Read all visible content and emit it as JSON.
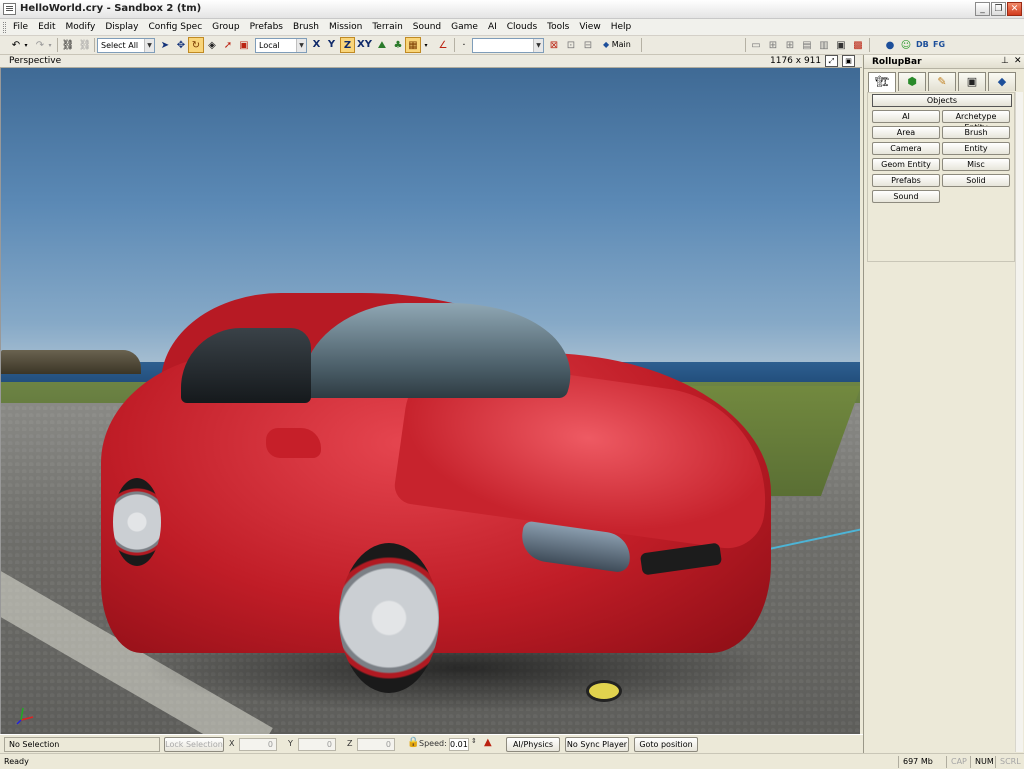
{
  "window": {
    "title": "HelloWorld.cry - Sandbox 2 (tm)",
    "minimize": "_",
    "restore": "❐",
    "close": "✕"
  },
  "menu": [
    "File",
    "Edit",
    "Modify",
    "Display",
    "Config Spec",
    "Group",
    "Prefabs",
    "Brush",
    "Mission",
    "Terrain",
    "Sound",
    "Game",
    "AI",
    "Clouds",
    "Tools",
    "View",
    "Help"
  ],
  "toolbar": {
    "selection_combo": "Select All",
    "coord_combo": "Local",
    "axes": [
      "X",
      "Y",
      "Z",
      "XY"
    ],
    "active_axis": "Z",
    "layer_combo": "",
    "layer_label": "Main",
    "db_label": "DB",
    "fg_label": "FG",
    "icons": [
      "undo-icon",
      "redo-icon",
      "link-icon",
      "unlink-icon",
      "select-icon",
      "move-icon",
      "rotate-icon",
      "scale-icon",
      "select-terrain-icon",
      "snap-icon",
      "terrain-icon",
      "vegetation-icon",
      "grid-icon",
      "angle-snap-icon",
      "goto-icon",
      "layers-icon"
    ]
  },
  "viewport": {
    "name": "Perspective",
    "resolution": "1176 x 911"
  },
  "rollup": {
    "title": "RollupBar",
    "tabs": [
      "objects-tab-icon",
      "terrain-tab-icon",
      "modify-tab-icon",
      "display-tab-icon",
      "layers-tab-icon"
    ],
    "objects_label": "Objects",
    "buttons": [
      "AI",
      "Archetype Entity",
      "Area",
      "Brush",
      "Camera",
      "Entity",
      "Geom Entity",
      "Misc",
      "Prefabs",
      "Solid",
      "Sound"
    ]
  },
  "status": {
    "selection": "No Selection",
    "lock_selection": "Lock Selection",
    "x_label": "X",
    "x_value": "0",
    "y_label": "Y",
    "y_value": "0",
    "z_label": "Z",
    "z_value": "0",
    "speed_label": "Speed:",
    "speed_value": "0.01",
    "ai_physics": "AI/Physics",
    "no_sync": "No Sync Player",
    "goto": "Goto position",
    "ready": "Ready",
    "memory": "697 Mb",
    "cap": "CAP",
    "num": "NUM",
    "scrl": "SCRL"
  }
}
